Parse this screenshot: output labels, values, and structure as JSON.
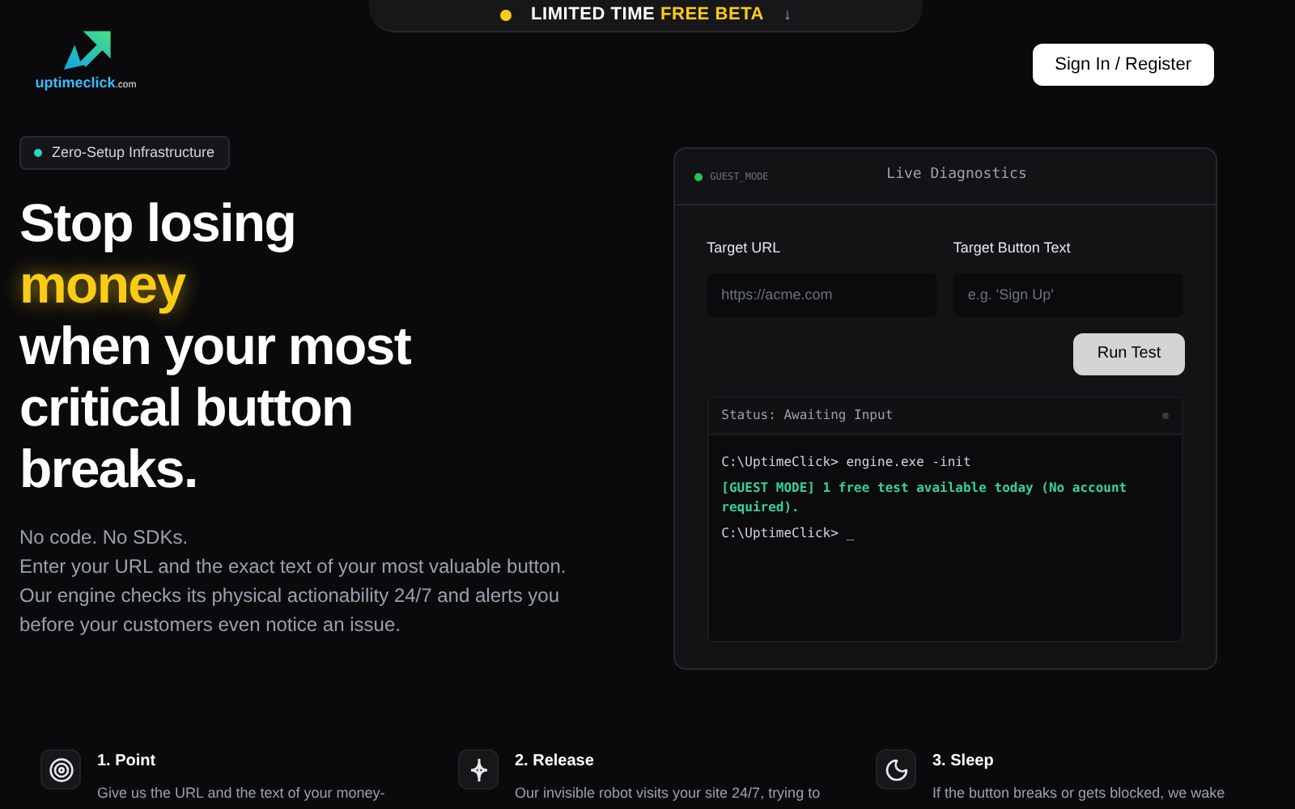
{
  "banner": {
    "text": "LIMITED TIME **FREE BETA**",
    "arrow": "↓"
  },
  "logo": {
    "name": "uptimeclick",
    "suffix": ".com"
  },
  "nav": {
    "button": "Sign In / Register"
  },
  "hero": {
    "badge": "Zero-Setup Infrastructure",
    "title_lines": [
      {
        "text": "Stop losing",
        "highlight": false
      },
      {
        "text": "money",
        "highlight": true
      },
      {
        "text": "when your most",
        "highlight": false
      },
      {
        "text": "critical button",
        "highlight": false
      },
      {
        "text": "breaks.",
        "highlight": false
      }
    ],
    "paragraphs": [
      "No code. No SDKs.",
      "Enter your URL and the exact text of your most valuable button. Our engine checks its physical actionability 24/7 and alerts you before your customers even notice an issue."
    ]
  },
  "panel": {
    "mode": "GUEST_MODE",
    "title": "Live Diagnostics",
    "fields": [
      {
        "label": "Target URL",
        "placeholder": "https://acme.com"
      },
      {
        "label": "Target Button Text",
        "placeholder": "e.g. 'Sign Up'"
      }
    ],
    "button": "Run Test",
    "status": "Status: Awaiting Input",
    "terminal": [
      {
        "kind": "command",
        "text": "C:\\UptimeClick> engine.exe -init"
      },
      {
        "kind": "success",
        "text": "[GUEST MODE] 1 free test available today (No account required)."
      },
      {
        "kind": "prompt",
        "text": "C:\\UptimeClick> _"
      }
    ]
  },
  "steps": [
    {
      "kind": "target",
      "title": "1. Point",
      "text": "Give us the URL and the text of your money-"
    },
    {
      "kind": "release",
      "title": "2. Release",
      "text": "Our invisible robot visits your site 24/7, trying to"
    },
    {
      "kind": "sleep",
      "title": "3. Sleep",
      "text": "If the button breaks or gets blocked, we wake"
    }
  ]
}
